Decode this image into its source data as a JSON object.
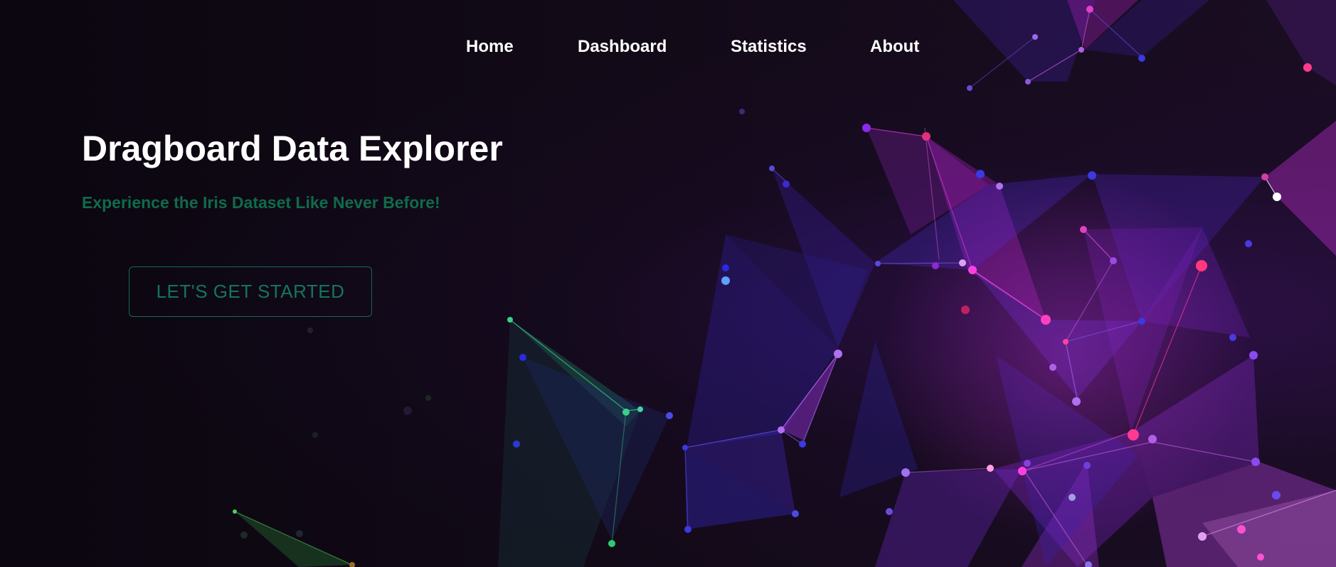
{
  "nav": {
    "items": [
      {
        "label": "Home"
      },
      {
        "label": "Dashboard"
      },
      {
        "label": "Statistics"
      },
      {
        "label": "About"
      }
    ]
  },
  "hero": {
    "title": "Dragboard Data Explorer",
    "subtitle": "Experience the Iris Dataset Like Never Before!",
    "cta_label": "LET'S GET STARTED"
  },
  "colors": {
    "background": "#0c0710",
    "accent_green": "#0f6b4a",
    "network_purple": "#7a2bd6",
    "network_magenta": "#e024c8",
    "network_blue": "#3a2be0",
    "network_green": "#2ecc71"
  }
}
